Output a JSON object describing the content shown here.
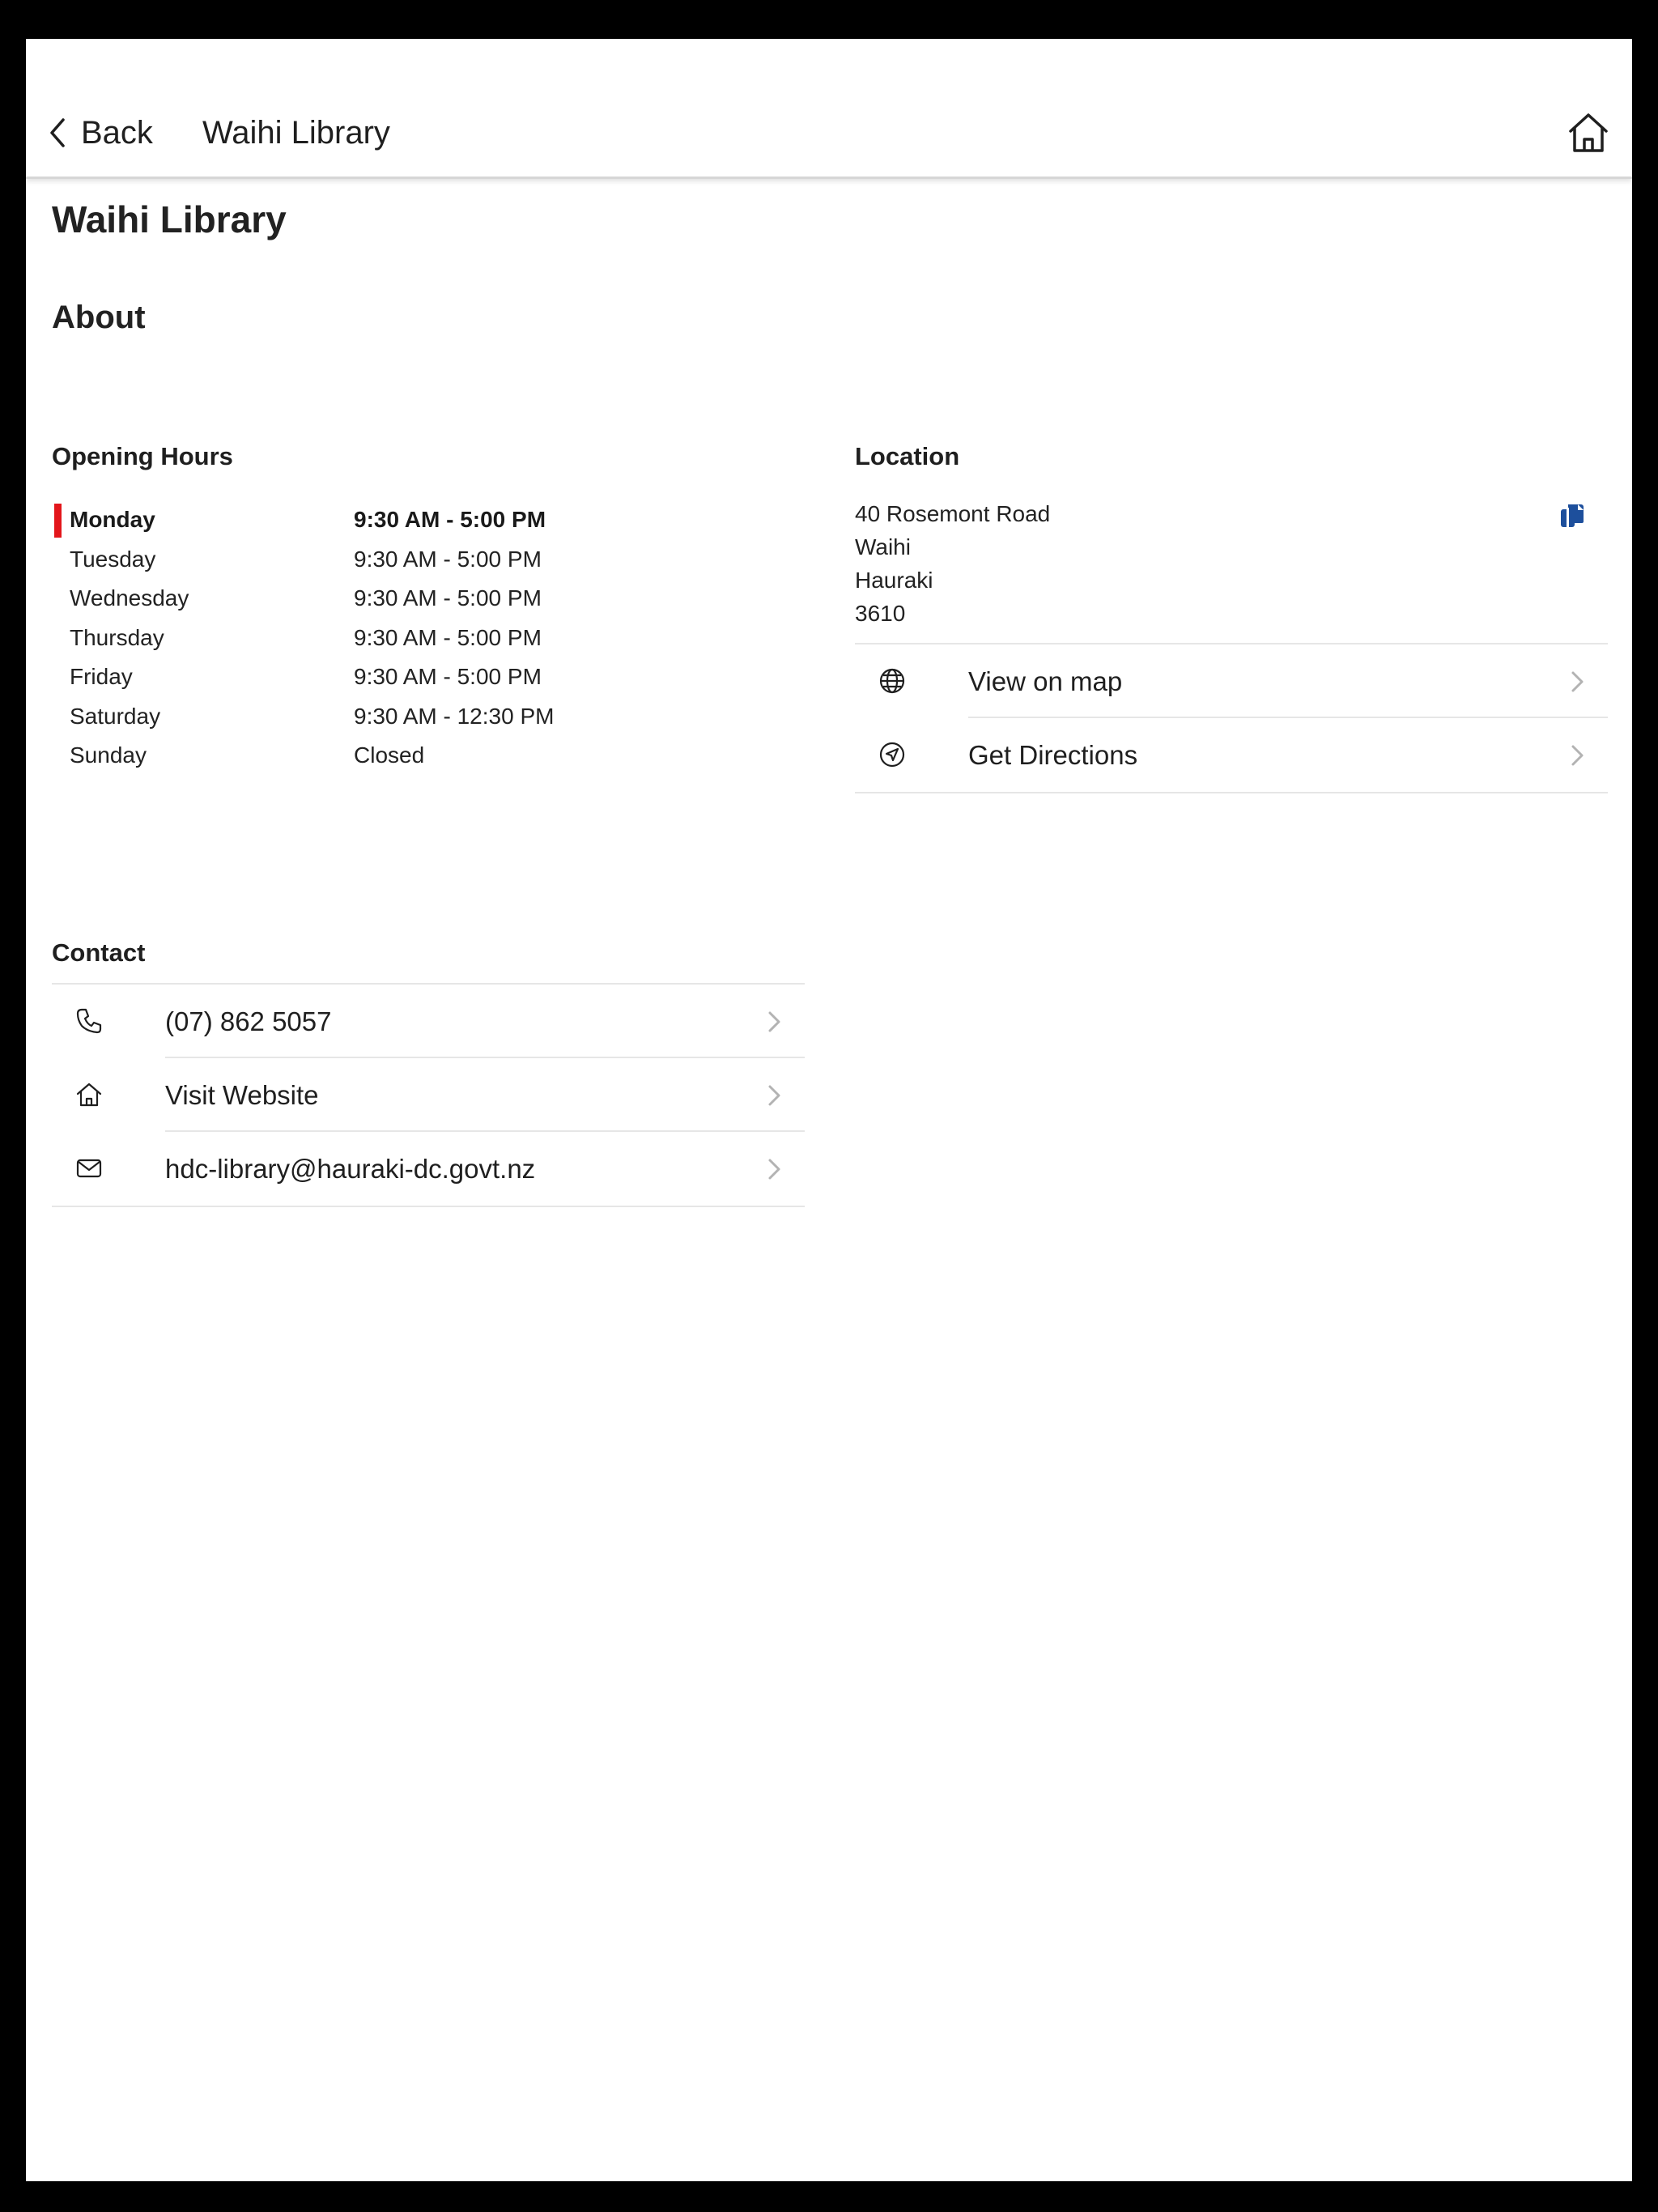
{
  "nav": {
    "back_label": "Back",
    "title": "Waihi Library"
  },
  "page": {
    "title": "Waihi Library",
    "about_heading": "About"
  },
  "opening_hours": {
    "heading": "Opening Hours",
    "today_color": "#e3161b",
    "days": [
      {
        "day": "Monday",
        "hours": "9:30 AM - 5:00 PM",
        "today": true
      },
      {
        "day": "Tuesday",
        "hours": "9:30 AM - 5:00 PM",
        "today": false
      },
      {
        "day": "Wednesday",
        "hours": "9:30 AM - 5:00 PM",
        "today": false
      },
      {
        "day": "Thursday",
        "hours": "9:30 AM - 5:00 PM",
        "today": false
      },
      {
        "day": "Friday",
        "hours": "9:30 AM - 5:00 PM",
        "today": false
      },
      {
        "day": "Saturday",
        "hours": "9:30 AM - 12:30 PM",
        "today": false
      },
      {
        "day": "Sunday",
        "hours": "Closed",
        "today": false
      }
    ]
  },
  "location": {
    "heading": "Location",
    "address": [
      "40 Rosemont Road",
      "Waihi",
      "Hauraki",
      "3610"
    ],
    "copy_icon": "copy-icon",
    "copy_icon_color": "#1d4f9c",
    "actions": [
      {
        "label": "View on map",
        "icon": "globe-icon"
      },
      {
        "label": "Get Directions",
        "icon": "navigation-icon"
      }
    ]
  },
  "contact": {
    "heading": "Contact",
    "items": [
      {
        "label": "(07) 862 5057",
        "icon": "phone-icon"
      },
      {
        "label": "Visit Website",
        "icon": "home-icon"
      },
      {
        "label": "hdc-library@hauraki-dc.govt.nz",
        "icon": "mail-icon"
      }
    ]
  }
}
